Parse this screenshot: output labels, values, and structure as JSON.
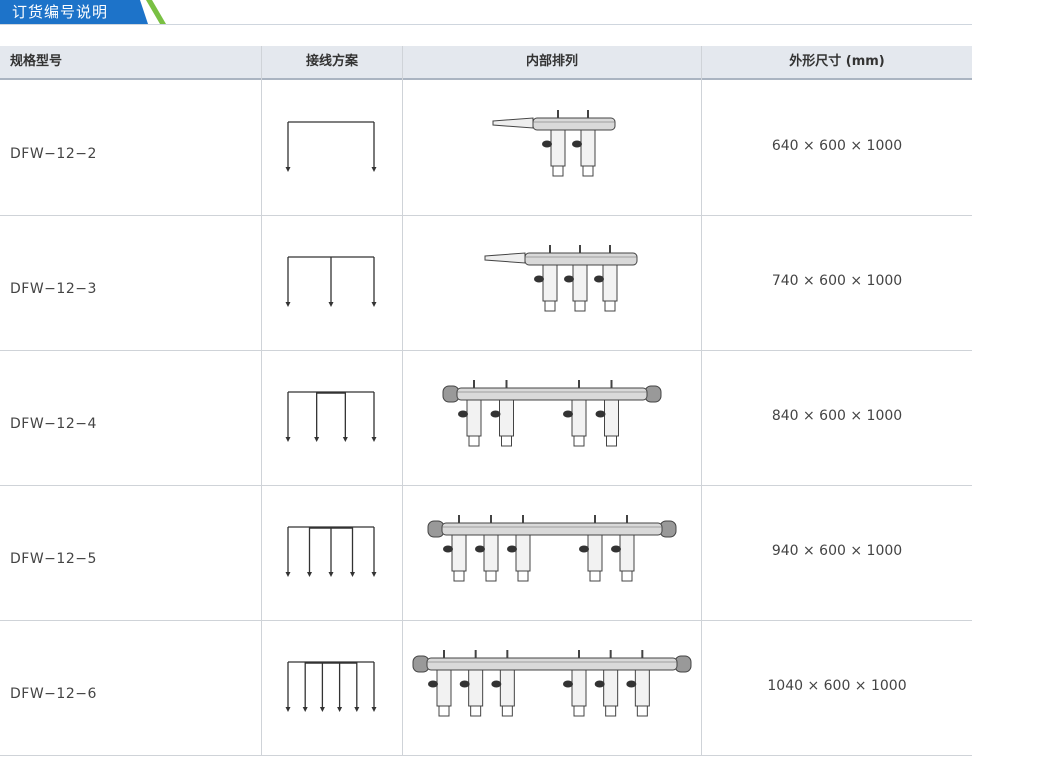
{
  "section": {
    "title": "订货编号说明",
    "tab_color": "#1d73c9",
    "stripe_color": "#79c043"
  },
  "table": {
    "headers": [
      "规格型号",
      "接线方案",
      "内部排列",
      "外形尺寸 (mm)"
    ],
    "rows": [
      {
        "model": "DFW−12−2",
        "dims": "640 × 600 × 1000",
        "ways": 2
      },
      {
        "model": "DFW−12−3",
        "dims": "740 × 600 × 1000",
        "ways": 3
      },
      {
        "model": "DFW−12−4",
        "dims": "840 × 600 × 1000",
        "ways": 4
      },
      {
        "model": "DFW−12−5",
        "dims": "940 × 600 × 1000",
        "ways": 5
      },
      {
        "model": "DFW−12−6",
        "dims": "1040 × 600 × 1000",
        "ways": 6
      }
    ]
  }
}
